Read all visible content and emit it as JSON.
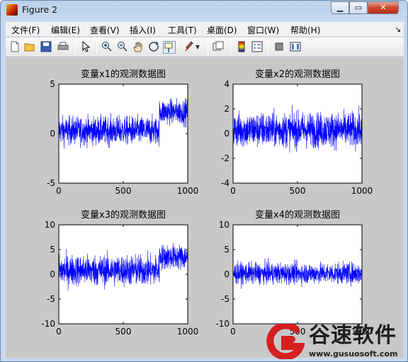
{
  "window": {
    "title": "Figure 2",
    "controls": {
      "minimize": "▁",
      "maximize": "▭",
      "close": "✕"
    }
  },
  "menu": [
    "文件(F)",
    "编辑(E)",
    "查看(V)",
    "插入(I)",
    "工具(T)",
    "桌面(D)",
    "窗口(W)",
    "帮助(H)"
  ],
  "menu_arrow": "↘",
  "toolbar": {
    "icons": [
      "new-figure-icon",
      "open-file-icon",
      "save-icon",
      "print-icon",
      "edit-plot-arrow-icon",
      "zoom-in-icon",
      "zoom-out-icon",
      "pan-hand-icon",
      "rotate-3d-icon",
      "data-cursor-icon",
      "brush-icon",
      "brush-dropdown-icon",
      "link-plot-icon",
      "colorbar-icon",
      "legend-icon",
      "hide-plot-tools-icon",
      "show-plot-tools-icon"
    ]
  },
  "chart_data": [
    {
      "type": "line",
      "title": "变量x1的观测数据图",
      "xlim": [
        0,
        1000
      ],
      "ylim": [
        -5,
        5
      ],
      "xticks": [
        "0",
        "500",
        "1000"
      ],
      "yticks": [
        "-5",
        "0",
        "5"
      ],
      "series": [
        {
          "color": "#0000ff",
          "n": 1000,
          "regimes": [
            {
              "x": [
                1,
                780
              ],
              "mean": 0.3,
              "spread": 1.0
            },
            {
              "x": [
                780,
                1000
              ],
              "mean": 2.2,
              "spread": 0.9
            }
          ]
        }
      ]
    },
    {
      "type": "line",
      "title": "变量x2的观测数据图",
      "xlim": [
        0,
        1000
      ],
      "ylim": [
        -4,
        4
      ],
      "xticks": [
        "0",
        "500",
        "1000"
      ],
      "yticks": [
        "-4",
        "-2",
        "0",
        "2",
        "4"
      ],
      "series": [
        {
          "color": "#0000ff",
          "n": 1000,
          "regimes": [
            {
              "x": [
                1,
                1000
              ],
              "mean": 0.3,
              "spread": 1.0
            }
          ]
        }
      ]
    },
    {
      "type": "line",
      "title": "变量x3的观测数据图",
      "xlim": [
        0,
        1000
      ],
      "ylim": [
        -10,
        10
      ],
      "xticks": [
        "0",
        "500",
        "1000"
      ],
      "yticks": [
        "-10",
        "-5",
        "0",
        "5",
        "10"
      ],
      "series": [
        {
          "color": "#0000ff",
          "n": 1000,
          "regimes": [
            {
              "x": [
                1,
                780
              ],
              "mean": 0.8,
              "spread": 2.2
            },
            {
              "x": [
                780,
                1000
              ],
              "mean": 3.5,
              "spread": 1.8
            }
          ]
        }
      ]
    },
    {
      "type": "line",
      "title": "变量x4的观测数据图",
      "xlim": [
        0,
        1000
      ],
      "ylim": [
        -10,
        10
      ],
      "xticks": [
        "0",
        "500",
        "1000"
      ],
      "yticks": [
        "-10",
        "-5",
        "0",
        "5",
        "10"
      ],
      "series": [
        {
          "color": "#0000ff",
          "n": 1000,
          "regimes": [
            {
              "x": [
                1,
                1000
              ],
              "mean": 0.2,
              "spread": 1.5
            }
          ]
        }
      ]
    }
  ],
  "watermark": {
    "brand": "谷速软件",
    "url": "www.gusuosoft.com",
    "colors": {
      "red": "#d42020",
      "dark": "#1e1e1e"
    }
  }
}
